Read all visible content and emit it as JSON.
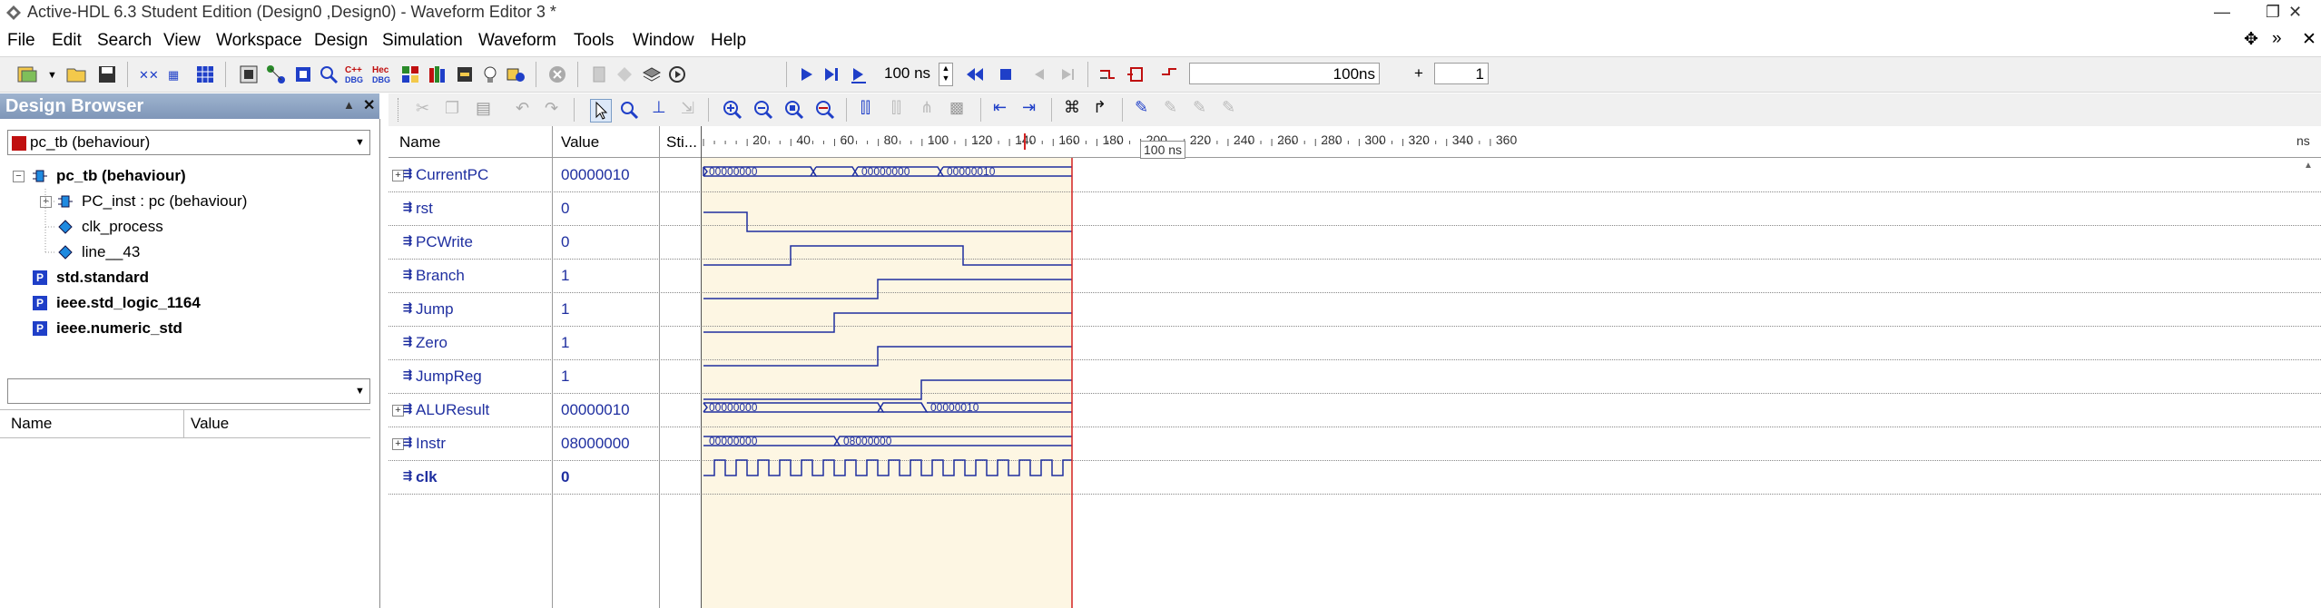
{
  "window": {
    "title": "Active-HDL 6.3 Student Edition (Design0 ,Design0) - Waveform Editor 3 *",
    "minimize": "—",
    "maximize": "❐",
    "close": "✕"
  },
  "menu": {
    "items": [
      "File",
      "Edit",
      "Search",
      "View",
      "Workspace",
      "Design",
      "Simulation",
      "Waveform",
      "Tools",
      "Window",
      "Help"
    ],
    "right_icons": [
      "move-icon",
      "chevron-right-icon",
      "close-icon"
    ]
  },
  "toolbar": {
    "run_for": "100 ns",
    "sim_time": "100ns",
    "plus": "+",
    "step_count": "1"
  },
  "design_browser": {
    "title": "Design Browser",
    "top_select": "pc_tb (behaviour)",
    "tree": [
      {
        "label": "pc_tb (behaviour)",
        "bold": true,
        "level": 0
      },
      {
        "label": "PC_inst : pc (behaviour)",
        "bold": false,
        "level": 1
      },
      {
        "label": "clk_process",
        "bold": false,
        "level": 1
      },
      {
        "label": "line__43",
        "bold": false,
        "level": 1
      },
      {
        "label": "std.standard",
        "bold": true,
        "level": 0
      },
      {
        "label": "ieee.std_logic_1164",
        "bold": true,
        "level": 0
      },
      {
        "label": "ieee.numeric_std",
        "bold": true,
        "level": 0
      }
    ],
    "lower_select": "",
    "columns": [
      "Name",
      "Value"
    ]
  },
  "waveform": {
    "columns": [
      "Name",
      "Value",
      "Sti..."
    ],
    "cursor_label": "100 ns",
    "ruler_ticks": [
      "20",
      "40",
      "60",
      "80",
      "100",
      "120",
      "140",
      "160",
      "180",
      "200",
      "220",
      "240",
      "260",
      "280",
      "300",
      "320",
      "340",
      "360"
    ],
    "ruler_unit": "ns",
    "signals": [
      {
        "name": "CurrentPC",
        "value": "00000010",
        "expandable": true,
        "bold": false
      },
      {
        "name": "rst",
        "value": "0",
        "expandable": false,
        "bold": false
      },
      {
        "name": "PCWrite",
        "value": "0",
        "expandable": false,
        "bold": false
      },
      {
        "name": "Branch",
        "value": "1",
        "expandable": false,
        "bold": false
      },
      {
        "name": "Jump",
        "value": "1",
        "expandable": false,
        "bold": false
      },
      {
        "name": "Zero",
        "value": "1",
        "expandable": false,
        "bold": false
      },
      {
        "name": "JumpReg",
        "value": "1",
        "expandable": false,
        "bold": false
      },
      {
        "name": "ALUResult",
        "value": "00000010",
        "expandable": true,
        "bold": false
      },
      {
        "name": "Instr",
        "value": "08000000",
        "expandable": true,
        "bold": false
      },
      {
        "name": "clk",
        "value": "0",
        "expandable": false,
        "bold": true
      }
    ],
    "bus_labels": {
      "CurrentPC": [
        "00000000",
        "00000000",
        "00000010"
      ],
      "ALUResult": [
        "00000000",
        "00000010"
      ],
      "Instr": [
        "00000000",
        "08000000"
      ]
    }
  },
  "colors": {
    "accent_wave": "#1f2fa0",
    "cursor": "#d32020",
    "sim_region": "#fdf6e3",
    "panel_header": "#8aa0c0"
  }
}
